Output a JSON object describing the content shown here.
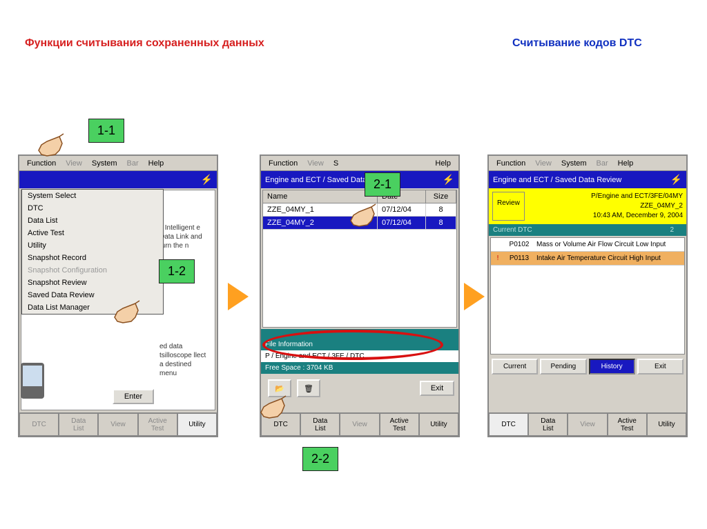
{
  "titles": {
    "left": "Функции считывания сохраненных данных",
    "right": "Считывание кодов DTC"
  },
  "steps": {
    "s11": "1-1",
    "s12": "1-2",
    "s21": "2-1",
    "s22": "2-2"
  },
  "menubar": {
    "function": "Function",
    "view": "View",
    "system": "System",
    "bar": "Bar",
    "help": "Help"
  },
  "dev1": {
    "dropdown": [
      "System Select",
      "DTC",
      "Data List",
      "Active Test",
      "Utility",
      "Snapshot Record",
      "Snapshot Configuration",
      "Snapshot Review",
      "Saved Data Review",
      "Data List Manager"
    ],
    "side1": "s Intelligent e Data Link and turn the n",
    "side2": "ed data tsilloscope llect a destined menu",
    "enter": "Enter"
  },
  "dev2": {
    "header": "Engine and ECT / Saved Data Review",
    "cols": {
      "name": "Name",
      "date": "Date",
      "size": "Size"
    },
    "rows": [
      {
        "name": "ZZE_04MY_1",
        "date": "07/12/04",
        "size": "8"
      },
      {
        "name": "ZZE_04MY_2",
        "date": "07/12/04",
        "size": "8"
      }
    ],
    "fileinfo": "File Information",
    "path": "P / Engine and ECT / 3FE / DTC",
    "freespace": "Free Space : 3704 KB",
    "exit": "Exit"
  },
  "dev3": {
    "header": "Engine and ECT / Saved Data Review",
    "review": "Review",
    "info1": "P/Engine and ECT/3FE/04MY",
    "info2": "ZZE_04MY_2",
    "info3": "10:43 AM, December 9, 2004",
    "curdtc": "Current DTC",
    "count": "2",
    "dtcs": [
      {
        "excl": "",
        "code": "P0102",
        "desc": "Mass or Volume Air Flow Circuit Low Input"
      },
      {
        "excl": "!",
        "code": "P0113",
        "desc": "Intake Air Temperature Circuit High Input"
      }
    ],
    "btns": {
      "current": "Current",
      "pending": "Pending",
      "history": "History",
      "exit": "Exit"
    }
  },
  "tabs": {
    "dtc": "DTC",
    "datalist": "Data\nList",
    "view": "View",
    "activetest": "Active\nTest",
    "utility": "Utility"
  }
}
